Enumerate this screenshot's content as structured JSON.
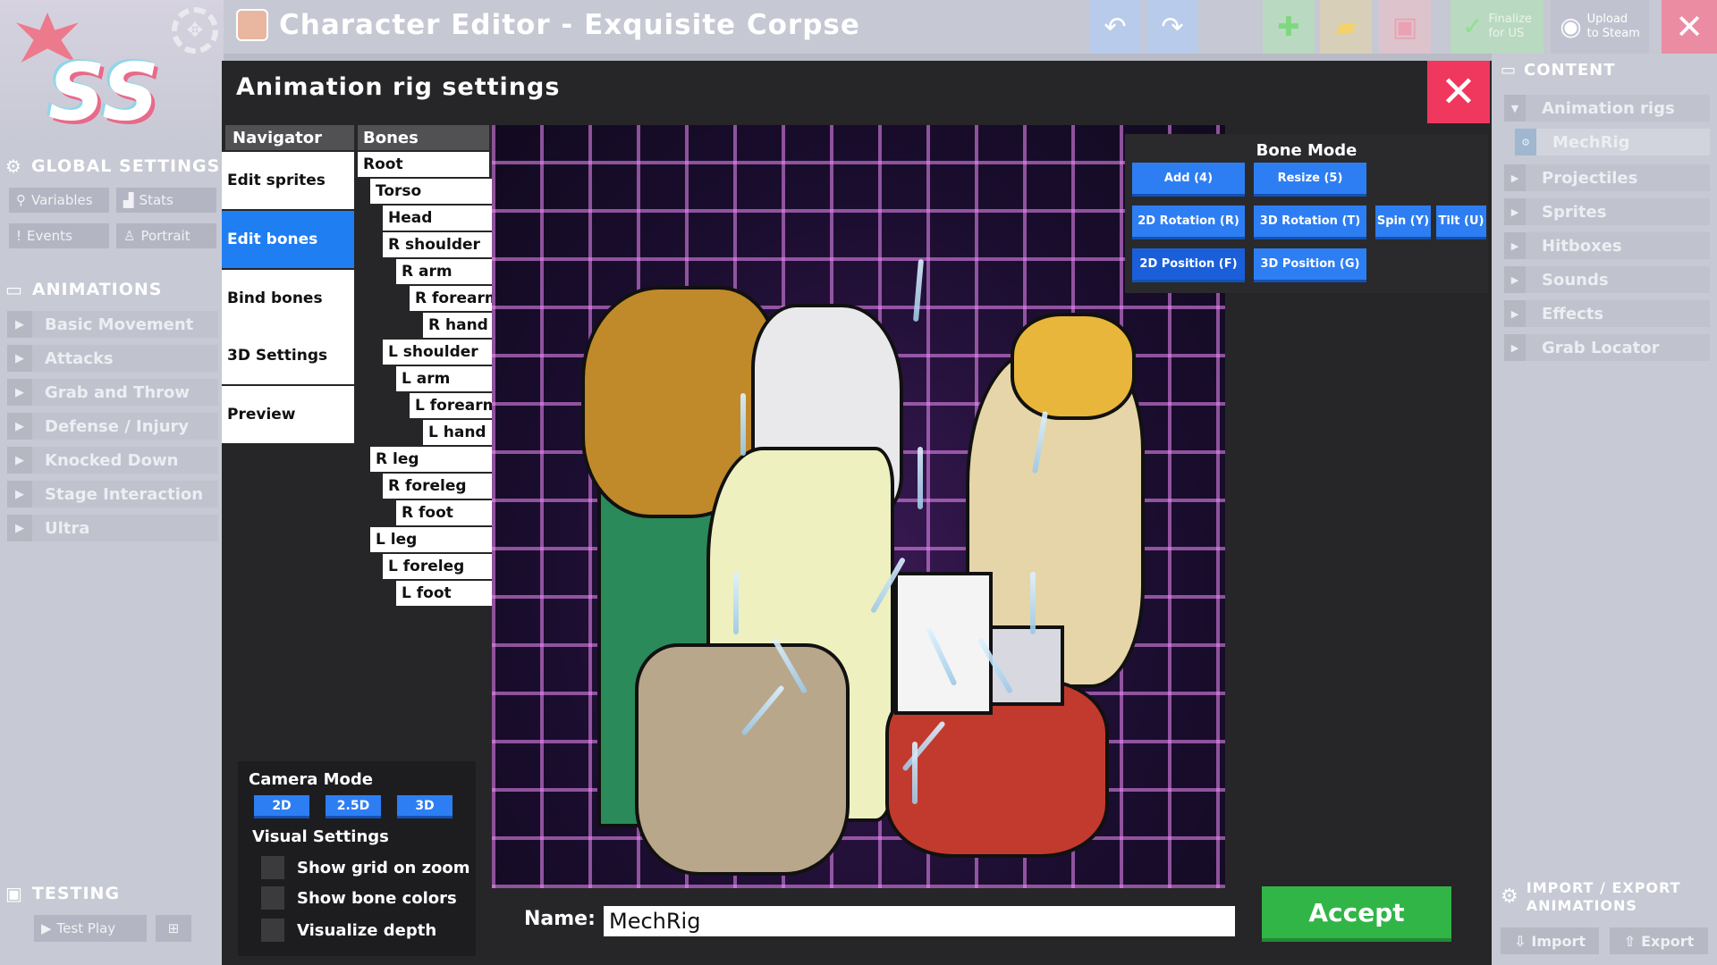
{
  "app": {
    "title": "Character Editor - Exquisite Corpse",
    "logo_text": "SS"
  },
  "toolbar": {
    "finalize_label": "Finalize\nfor US",
    "upload_label": "Upload\nto Steam"
  },
  "left_sidebar": {
    "global_settings": {
      "header": "GLOBAL SETTINGS",
      "buttons": [
        "Variables",
        "Stats",
        "Events",
        "Portrait"
      ]
    },
    "animations": {
      "header": "ANIMATIONS",
      "items": [
        "Basic Movement",
        "Attacks",
        "Grab and Throw",
        "Defense / Injury",
        "Knocked Down",
        "Stage Interaction",
        "Ultra"
      ]
    },
    "testing": {
      "header": "TESTING",
      "test_play_label": "Test Play"
    }
  },
  "right_sidebar": {
    "content_header": "CONTENT",
    "items": [
      "Animation rigs",
      "MechRig",
      "Projectiles",
      "Sprites",
      "Hitboxes",
      "Sounds",
      "Effects",
      "Grab Locator"
    ],
    "import_export_header": "IMPORT / EXPORT\nANIMATIONS",
    "import_label": "Import",
    "export_label": "Export"
  },
  "modal": {
    "title": "Animation rig settings",
    "navigator": {
      "header": "Navigator",
      "items": [
        "Edit sprites",
        "Edit bones",
        "Bind bones",
        "3D Settings",
        "Preview"
      ],
      "active_index": 1
    },
    "bones": {
      "header": "Bones",
      "tree": [
        "Root",
        "Torso",
        "Head",
        "R shoulder",
        "R arm",
        "R forearm",
        "R hand",
        "L shoulder",
        "L arm",
        "L forearm",
        "L hand",
        "R leg",
        "R foreleg",
        "R foot",
        "L leg",
        "L foreleg",
        "L foot"
      ]
    },
    "bone_mode": {
      "title": "Bone Mode",
      "buttons": [
        "Add (4)",
        "Resize (5)",
        "2D Rotation (R)",
        "3D Rotation (T)",
        "Spin (Y)",
        "Tilt (U)",
        "2D Position (F)",
        "3D Position (G)"
      ],
      "active": "2D Position (F)"
    },
    "camera": {
      "title": "Camera Mode",
      "buttons": [
        "2D",
        "2.5D",
        "3D"
      ]
    },
    "visual_settings": {
      "title": "Visual Settings",
      "options": [
        "Show grid on zoom",
        "Show bone colors",
        "Visualize depth"
      ]
    },
    "name_label": "Name:",
    "name_value": "MechRig",
    "accept_label": "Accept"
  },
  "colors": {
    "accent_blue": "#2d7ef3",
    "close_red": "#f0375e",
    "accept_green": "#31b547",
    "grid_pink": "#f08cfa"
  }
}
